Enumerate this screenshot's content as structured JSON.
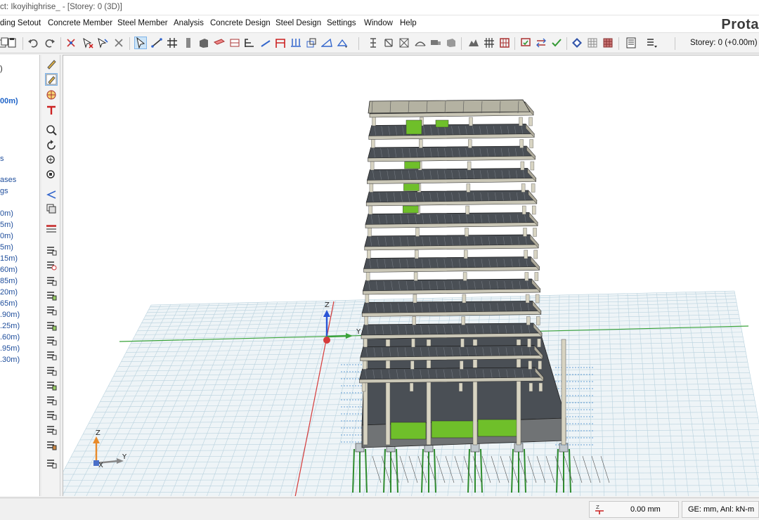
{
  "window": {
    "title": "ct: Ikoyihighrise_ - [Storey: 0 (3D)]",
    "brand": "Prota"
  },
  "menu": {
    "items": [
      "ding Setout",
      "Concrete Member",
      "Steel Member",
      "Analysis",
      "Concrete Design",
      "Steel Design",
      "Settings",
      "Window",
      "Help"
    ]
  },
  "toolbar": {
    "storey_selector": "Storey: 0 (+0.00m)",
    "icons": [
      "copy-icon",
      "paste-icon",
      "undo-icon",
      "redo-icon",
      "add-node-icon",
      "delete-node-icon",
      "select-pointer-icon",
      "line-icon",
      "grid-icon",
      "column-icon",
      "wall-icon",
      "beam-icon",
      "slab-icon",
      "stair-icon",
      "frame-icon",
      "foundation-icon",
      "section-icon",
      "dimension-icon",
      "pattern-icon",
      "hill-icon",
      "chart-icon",
      "load-icon",
      "design-icon",
      "check-icon",
      "render-icon",
      "table-icon",
      "report-icon"
    ]
  },
  "tree": {
    "items": [
      {
        "text": ")",
        "style": "black"
      },
      {
        "text": "00m)",
        "style": "bold"
      },
      {
        "text": "s",
        "style": "normal"
      },
      {
        "text": "ases",
        "style": "normal"
      },
      {
        "text": "gs",
        "style": "normal"
      },
      {
        "text": "0m)",
        "style": "normal"
      },
      {
        "text": "5m)",
        "style": "normal"
      },
      {
        "text": "0m)",
        "style": "normal"
      },
      {
        "text": "5m)",
        "style": "normal"
      },
      {
        "text": "15m)",
        "style": "normal"
      },
      {
        "text": "60m)",
        "style": "normal"
      },
      {
        "text": "85m)",
        "style": "normal"
      },
      {
        "text": "20m)",
        "style": "normal"
      },
      {
        "text": "65m)",
        "style": "normal"
      },
      {
        "text": ".90m)",
        "style": "normal"
      },
      {
        "text": ".25m)",
        "style": "normal"
      },
      {
        "text": ".60m)",
        "style": "normal"
      },
      {
        "text": ".95m)",
        "style": "normal"
      },
      {
        "text": ".30m)",
        "style": "normal"
      }
    ]
  },
  "viewport": {
    "axis_origin_labels": {
      "z": "Z",
      "y": "Y"
    },
    "corner_triad_labels": {
      "z": "Z",
      "x": "X",
      "y": "Y"
    },
    "colors": {
      "slab": "#4a4f55",
      "beam": "#c9c6b6",
      "column": "#d8d4c2",
      "core_wall": "#6fbf2a",
      "pile": "#2e8b2e",
      "grid": "#b9d2de",
      "x_axis": "#d63a3a",
      "y_axis": "#3aa33a",
      "z_axis": "#2a55d6"
    }
  },
  "status": {
    "elevation": "0.00 mm",
    "units": "GE: mm,  Anl: kN-m"
  }
}
